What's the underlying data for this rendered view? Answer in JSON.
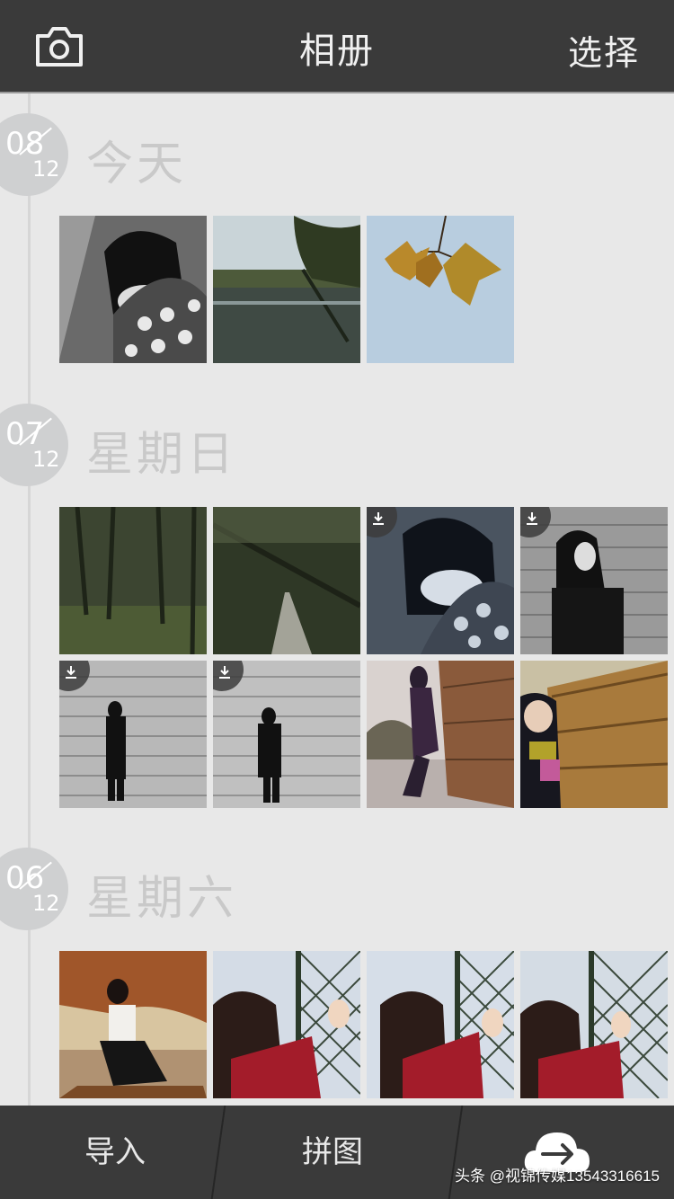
{
  "header": {
    "title": "相册",
    "select_label": "选择",
    "camera_icon": "camera-icon"
  },
  "sections": [
    {
      "day": "08",
      "month": "12",
      "label": "今天",
      "photos": [
        {
          "desc": "girl-scarf-bw",
          "download": false
        },
        {
          "desc": "lake-trees",
          "download": false
        },
        {
          "desc": "autumn-leaves-sky",
          "download": false
        }
      ]
    },
    {
      "day": "07",
      "month": "12",
      "label": "星期日",
      "photos": [
        {
          "desc": "forest",
          "download": false
        },
        {
          "desc": "forest-path",
          "download": false
        },
        {
          "desc": "girl-scarf-blue",
          "download": true
        },
        {
          "desc": "girl-wall-bw",
          "download": true
        },
        {
          "desc": "girl-wall-full-bw-1",
          "download": true
        },
        {
          "desc": "girl-wall-full-bw-2",
          "download": true
        },
        {
          "desc": "girl-leaning-wall",
          "download": false
        },
        {
          "desc": "girl-wood-wall",
          "download": false
        }
      ]
    },
    {
      "day": "06",
      "month": "12",
      "label": "星期六",
      "photos": [
        {
          "desc": "girl-autumn-sitting",
          "download": false
        },
        {
          "desc": "girl-fence-1",
          "download": false
        },
        {
          "desc": "girl-fence-2",
          "download": false
        },
        {
          "desc": "girl-fence-3",
          "download": false
        }
      ]
    }
  ],
  "footer": {
    "import_label": "导入",
    "collage_label": "拼图",
    "upload_icon": "cloud-upload-icon"
  },
  "watermark": "头条 @视锦传媒13543316615",
  "colors": {
    "bar": "#3a3a3a",
    "background": "#e8e8e8",
    "badge": "#cfd0d1",
    "label": "#c9c9c9"
  }
}
